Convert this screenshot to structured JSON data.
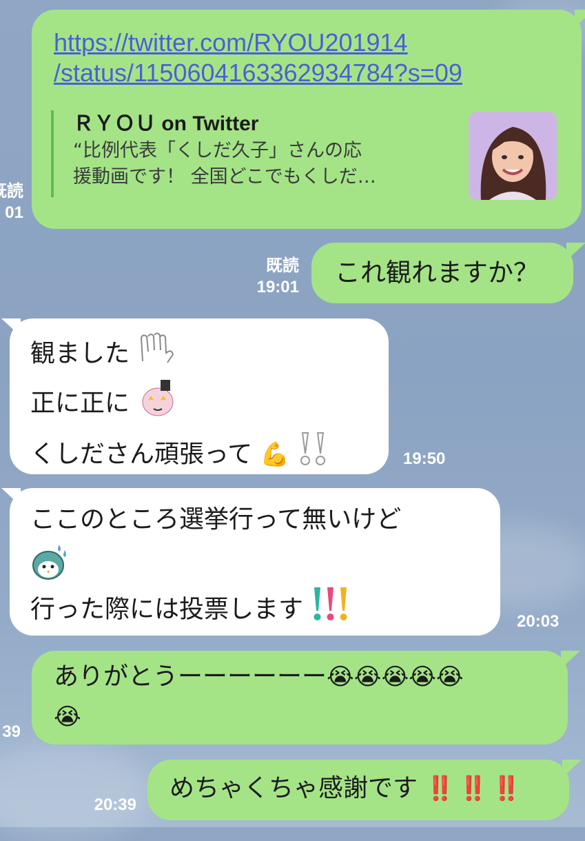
{
  "messages": [
    {
      "url_line1": "https://twitter.com/RYOU201914",
      "url_line2": "/status/1150604163362934784?s=09",
      "preview_title": "ＲＹＯＵ on Twitter",
      "preview_desc1": "“比例代表「くしだ久子」さんの応",
      "preview_desc2": "援動画です！ 全国どこでもくしだ…",
      "read": "既読",
      "time": "01"
    },
    {
      "text": "これ観れますか？",
      "read": "既読",
      "time": "19:01"
    },
    {
      "line1": "観ました",
      "line2": "正に正に",
      "line3": "くしださん頑張って",
      "line3_emoji": "💪",
      "time": "19:50"
    },
    {
      "line1": "ここのところ選挙行って無いけど",
      "line3": "行った際には投票します",
      "line3_emoji": "!!!",
      "time": "20:03"
    },
    {
      "line1": "ありがとうーーーーーー",
      "emoji": "😭😭😭😭😭",
      "emoji2": "😭",
      "time": "39"
    },
    {
      "text": "めちゃくちゃ感謝です",
      "emoji": "‼️‼️‼️",
      "time": "20:39"
    }
  ],
  "colors": {
    "outgoing": "#a4e487",
    "incoming": "#ffffff",
    "link": "#4c5fd6",
    "background": "#8fa6c4"
  },
  "icons": [
    "hand-icon",
    "bunny-sticker-icon",
    "muscle-icon",
    "double-exclamation-icon",
    "bird-sweat-icon",
    "colored-exclamation-icon",
    "crying-face-icon",
    "red-exclamation-icon"
  ]
}
